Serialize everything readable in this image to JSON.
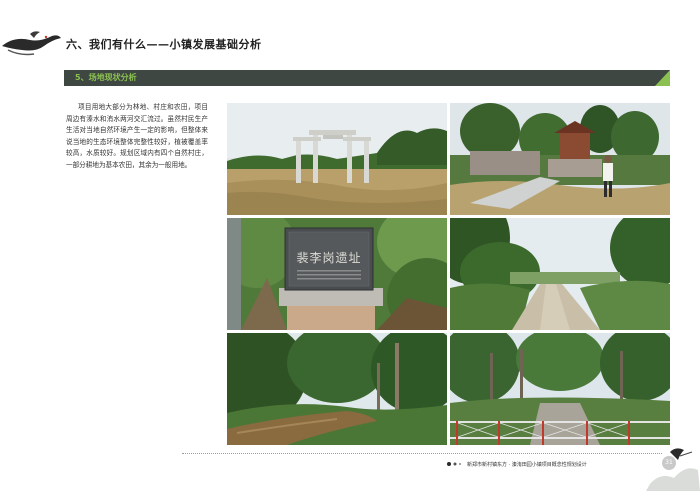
{
  "header": {
    "section_title": "六、我们有什么——小镇发展基础分析"
  },
  "band": {
    "title": "5、场地现状分析",
    "accent_color": "#8cc152",
    "band_color": "#3f4742"
  },
  "body": {
    "paragraph": "项目用地大部分为林地、村庄和农田，项目周边有溱水和洧水两河交汇流过。虽然村民生产生活对当地自然环境产生一定的影响，但整体来说当地的生态环境整体完整性较好，植被覆盖率较高，水质较好。规划区域内有四个自然村庄，一部分耕地为基本农田，其余为一般用地。"
  },
  "photos": {
    "stone_tablet_text": "裴李岗遗址"
  },
  "footer": {
    "project_title": "新郑市新村镇东方 · 溱洧田园小镇项目概念性规划设计",
    "page_number": "31"
  }
}
